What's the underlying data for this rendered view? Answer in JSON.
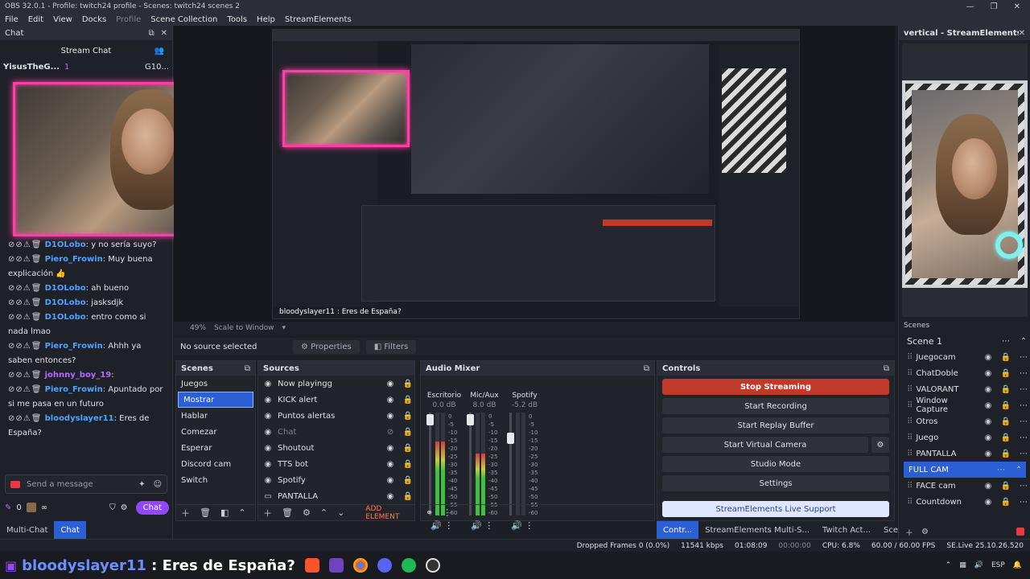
{
  "window": {
    "title": "OBS 32.0.1 - Profile: twitch24 profile - Scenes: twitch24 scenes 2",
    "controls": [
      "—",
      "❐",
      "✕"
    ]
  },
  "menu": [
    "File",
    "Edit",
    "View",
    "Docks",
    "Profile",
    "Scene Collection",
    "Tools",
    "Help",
    "StreamElements"
  ],
  "chat_dock": {
    "title": "Chat",
    "stream_chat_label": "Stream Chat",
    "top_user": "YisusTheG...",
    "top_user_count": "1",
    "gift_label": "G10...",
    "messages": [
      {
        "user": "D1OLobo",
        "text": ": y no sería suyo?",
        "color": "#4fa3ff"
      },
      {
        "user": "Piero_Frowin",
        "text": ": Muy buena explicación 👍",
        "color": "#4fa3ff"
      },
      {
        "user": "D1OLobo",
        "text": ": ah bueno",
        "color": "#4fa3ff"
      },
      {
        "user": "D1OLobo",
        "text": ": jasksdjk",
        "color": "#4fa3ff"
      },
      {
        "user": "D1OLobo",
        "text": ": entro como si nada lmao",
        "color": "#4fa3ff"
      },
      {
        "user": "Piero_Frowin",
        "text": ": Ahhh ya saben entonces?",
        "color": "#4fa3ff"
      },
      {
        "user": "johnny_boy_19",
        "text": ":",
        "color": "#b36bff"
      },
      {
        "user": "Piero_Frowin",
        "text": ": Apuntado por si me pasa en un futuro",
        "color": "#4fa3ff"
      },
      {
        "user": "bloodyslayer11",
        "text": ": Eres de España?",
        "color": "#4fa3ff"
      }
    ],
    "send_placeholder": "Send a message",
    "points": "0",
    "infinity": "∞",
    "chat_button": "Chat",
    "tabs": [
      "Multi-Chat",
      "Chat"
    ]
  },
  "preview": {
    "zoom": "49%",
    "scale_mode": "Scale to Window",
    "nested_overlay": "bloodyslayer11 : Eres de España?"
  },
  "toolbar": {
    "no_source": "No source selected",
    "properties": "Properties",
    "filters": "Filters"
  },
  "scenes_panel": {
    "title": "Scenes",
    "items": [
      "Juegos",
      "Mostrar",
      "Hablar",
      "Comezar",
      "Esperar",
      "Discord cam",
      "Switch"
    ],
    "selected": "Mostrar"
  },
  "sources_panel": {
    "title": "Sources",
    "items": [
      {
        "name": "Now playingg",
        "icon": "◉"
      },
      {
        "name": "KICK alert",
        "icon": "◉"
      },
      {
        "name": "Puntos alertas",
        "icon": "◉"
      },
      {
        "name": "Chat",
        "icon": "◉"
      },
      {
        "name": "Shoutout",
        "icon": "◉"
      },
      {
        "name": "TTS bot",
        "icon": "◉"
      },
      {
        "name": "Spotify",
        "icon": "◉"
      },
      {
        "name": "PANTALLA",
        "icon": "▭"
      }
    ],
    "add_element": "ADD ELEMENT"
  },
  "mixer": {
    "title": "Audio Mixer",
    "channels": [
      {
        "name": "Escritorio",
        "db": "0.0 dB",
        "level": 0.72,
        "fader": 0.98
      },
      {
        "name": "Mic/Aux",
        "db": "8.0 dB",
        "level": 0.6,
        "fader": 0.98
      },
      {
        "name": "Spotify",
        "db": "-5.2 dB",
        "level": 0.0,
        "fader": 0.78
      }
    ],
    "scale": [
      "0",
      "-5",
      "-10",
      "-15",
      "-20",
      "-25",
      "-30",
      "-35",
      "-40",
      "-45",
      "-50",
      "-55",
      "-60"
    ]
  },
  "controls": {
    "title": "Controls",
    "stop_streaming": "Stop Streaming",
    "start_recording": "Start Recording",
    "start_replay": "Start Replay Buffer",
    "start_virtual_cam": "Start Virtual Camera",
    "studio_mode": "Studio Mode",
    "settings": "Settings",
    "se_support": "StreamElements Live Support",
    "tabs": [
      "Contr...",
      "StreamElements Multi-S...",
      "Twitch Act...",
      "Scene Tr..."
    ]
  },
  "right_dock": {
    "title": "vertical - StreamElements C...",
    "scenes_label": "Scenes",
    "scene_name": "Scene 1",
    "items": [
      "Juegocam",
      "ChatDoble",
      "VALORANT",
      "Window Capture",
      "Otros",
      "Juego",
      "PANTALLA",
      "FULL CAM",
      "FACE cam",
      "Countdown"
    ],
    "selected": "FULL CAM"
  },
  "status": {
    "dropped": "Dropped Frames 0 (0.0%)",
    "kbps": "11541 kbps",
    "live_time": "01:08:09",
    "rec_time": "00:00:00",
    "cpu": "CPU: 6.8%",
    "fps": "60.00 / 60.00 FPS",
    "se_version": "SE.Live 25.10.26.520"
  },
  "taskbar": {
    "user": "bloodyslayer11",
    "message": " : Eres de España?",
    "lang": "ESP"
  }
}
